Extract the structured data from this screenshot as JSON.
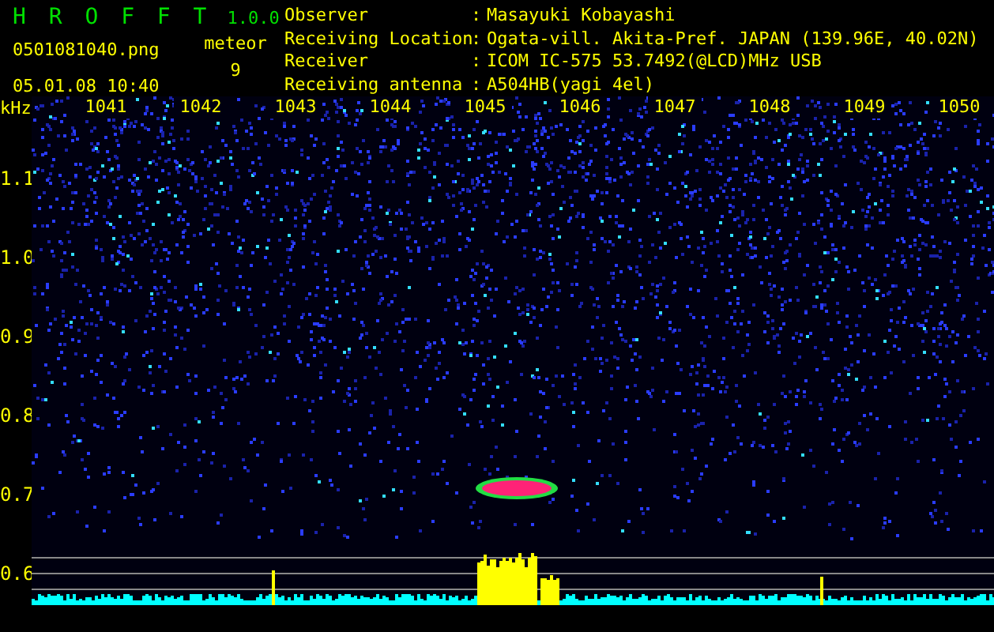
{
  "app": {
    "name": "H R O F F T",
    "version": "1.0.0"
  },
  "file": {
    "name": "0501081040.png",
    "datetime": "05.01.08 10:40"
  },
  "meteor": {
    "label": "meteor",
    "count": "9"
  },
  "info": [
    {
      "label": "Observer",
      "separator": ":",
      "value": "Masayuki Kobayashi"
    },
    {
      "label": "Receiving Location",
      "separator": ":",
      "value": "Ogata-vill. Akita-Pref. JAPAN (139.96E, 40.02N)"
    },
    {
      "label": "Receiver",
      "separator": ":",
      "value": "ICOM IC-575 53.7492(@LCD)MHz USB"
    },
    {
      "label": "Receiving antenna",
      "separator": ":",
      "value": "A504HB(yagi 4el)"
    }
  ],
  "plot": {
    "y_unit": "kHz",
    "y_labels": [
      "1.1",
      "1.0",
      "0.9",
      "0.8",
      "0.7",
      "0.6"
    ],
    "x_labels": [
      "1041",
      "1042",
      "1043",
      "1044",
      "1045",
      "1046",
      "1047",
      "1048",
      "1049",
      "1050"
    ]
  }
}
